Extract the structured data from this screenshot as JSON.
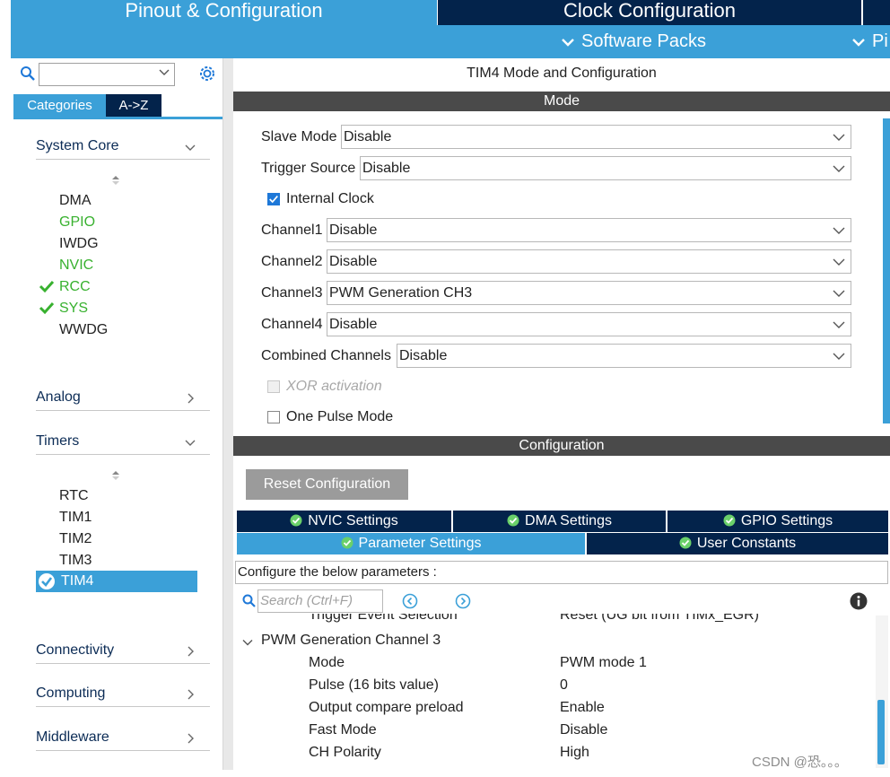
{
  "header": {
    "tab_pinout": "Pinout & Configuration",
    "tab_clock": "Clock Configuration",
    "software_packs": "Software Packs",
    "pinout_truncated": "Pi"
  },
  "sidebar": {
    "tabs": {
      "categories": "Categories",
      "az": "A->Z"
    },
    "sections": {
      "system_core": {
        "title": "System Core",
        "items": [
          {
            "label": "DMA",
            "status": "none"
          },
          {
            "label": "GPIO",
            "status": "green"
          },
          {
            "label": "IWDG",
            "status": "none"
          },
          {
            "label": "NVIC",
            "status": "green"
          },
          {
            "label": "RCC",
            "status": "checked"
          },
          {
            "label": "SYS",
            "status": "checked"
          },
          {
            "label": "WWDG",
            "status": "none"
          }
        ]
      },
      "analog": {
        "title": "Analog"
      },
      "timers": {
        "title": "Timers",
        "items": [
          {
            "label": "RTC"
          },
          {
            "label": "TIM1"
          },
          {
            "label": "TIM2"
          },
          {
            "label": "TIM3"
          },
          {
            "label": "TIM4"
          }
        ]
      },
      "connectivity": {
        "title": "Connectivity"
      },
      "computing": {
        "title": "Computing"
      },
      "middleware": {
        "title": "Middleware"
      }
    }
  },
  "main": {
    "title": "TIM4 Mode and Configuration",
    "mode_bar": "Mode",
    "fields": {
      "slave_mode": {
        "label": "Slave Mode",
        "value": "Disable"
      },
      "trigger_source": {
        "label": "Trigger Source",
        "value": "Disable"
      },
      "internal_clock": {
        "label": "Internal Clock",
        "checked": true
      },
      "channel1": {
        "label": "Channel1",
        "value": "Disable"
      },
      "channel2": {
        "label": "Channel2",
        "value": "Disable"
      },
      "channel3": {
        "label": "Channel3",
        "value": "PWM Generation CH3"
      },
      "channel4": {
        "label": "Channel4",
        "value": "Disable"
      },
      "combined": {
        "label": "Combined Channels",
        "value": "Disable"
      },
      "xor": {
        "label": "XOR activation"
      },
      "one_pulse": {
        "label": "One Pulse Mode"
      }
    },
    "config_bar": "Configuration",
    "reset_button": "Reset Configuration",
    "settings_tabs": {
      "nvic": "NVIC Settings",
      "dma": "DMA Settings",
      "gpio": "GPIO Settings",
      "parameter": "Parameter Settings",
      "user_constants": "User Constants"
    },
    "configure_hint": "Configure the below parameters :",
    "search_placeholder": "Search (Ctrl+F)",
    "params": {
      "partial_label": "Trigger Event Selection",
      "partial_value": "Reset (UG bit from TIMx_EGR)",
      "group": "PWM Generation Channel 3",
      "rows": [
        {
          "name": "Mode",
          "value": "PWM mode 1"
        },
        {
          "name": "Pulse (16 bits value)",
          "value": "0"
        },
        {
          "name": "Output compare preload",
          "value": "Enable"
        },
        {
          "name": "Fast Mode",
          "value": "Disable"
        },
        {
          "name": "CH Polarity",
          "value": "High"
        }
      ]
    }
  },
  "watermark": "CSDN @恐。。。",
  "colors": {
    "accent_blue": "#3ba0d8",
    "navy": "#03234b",
    "green": "#38b12f",
    "dark_bar": "#4a4a4a"
  }
}
